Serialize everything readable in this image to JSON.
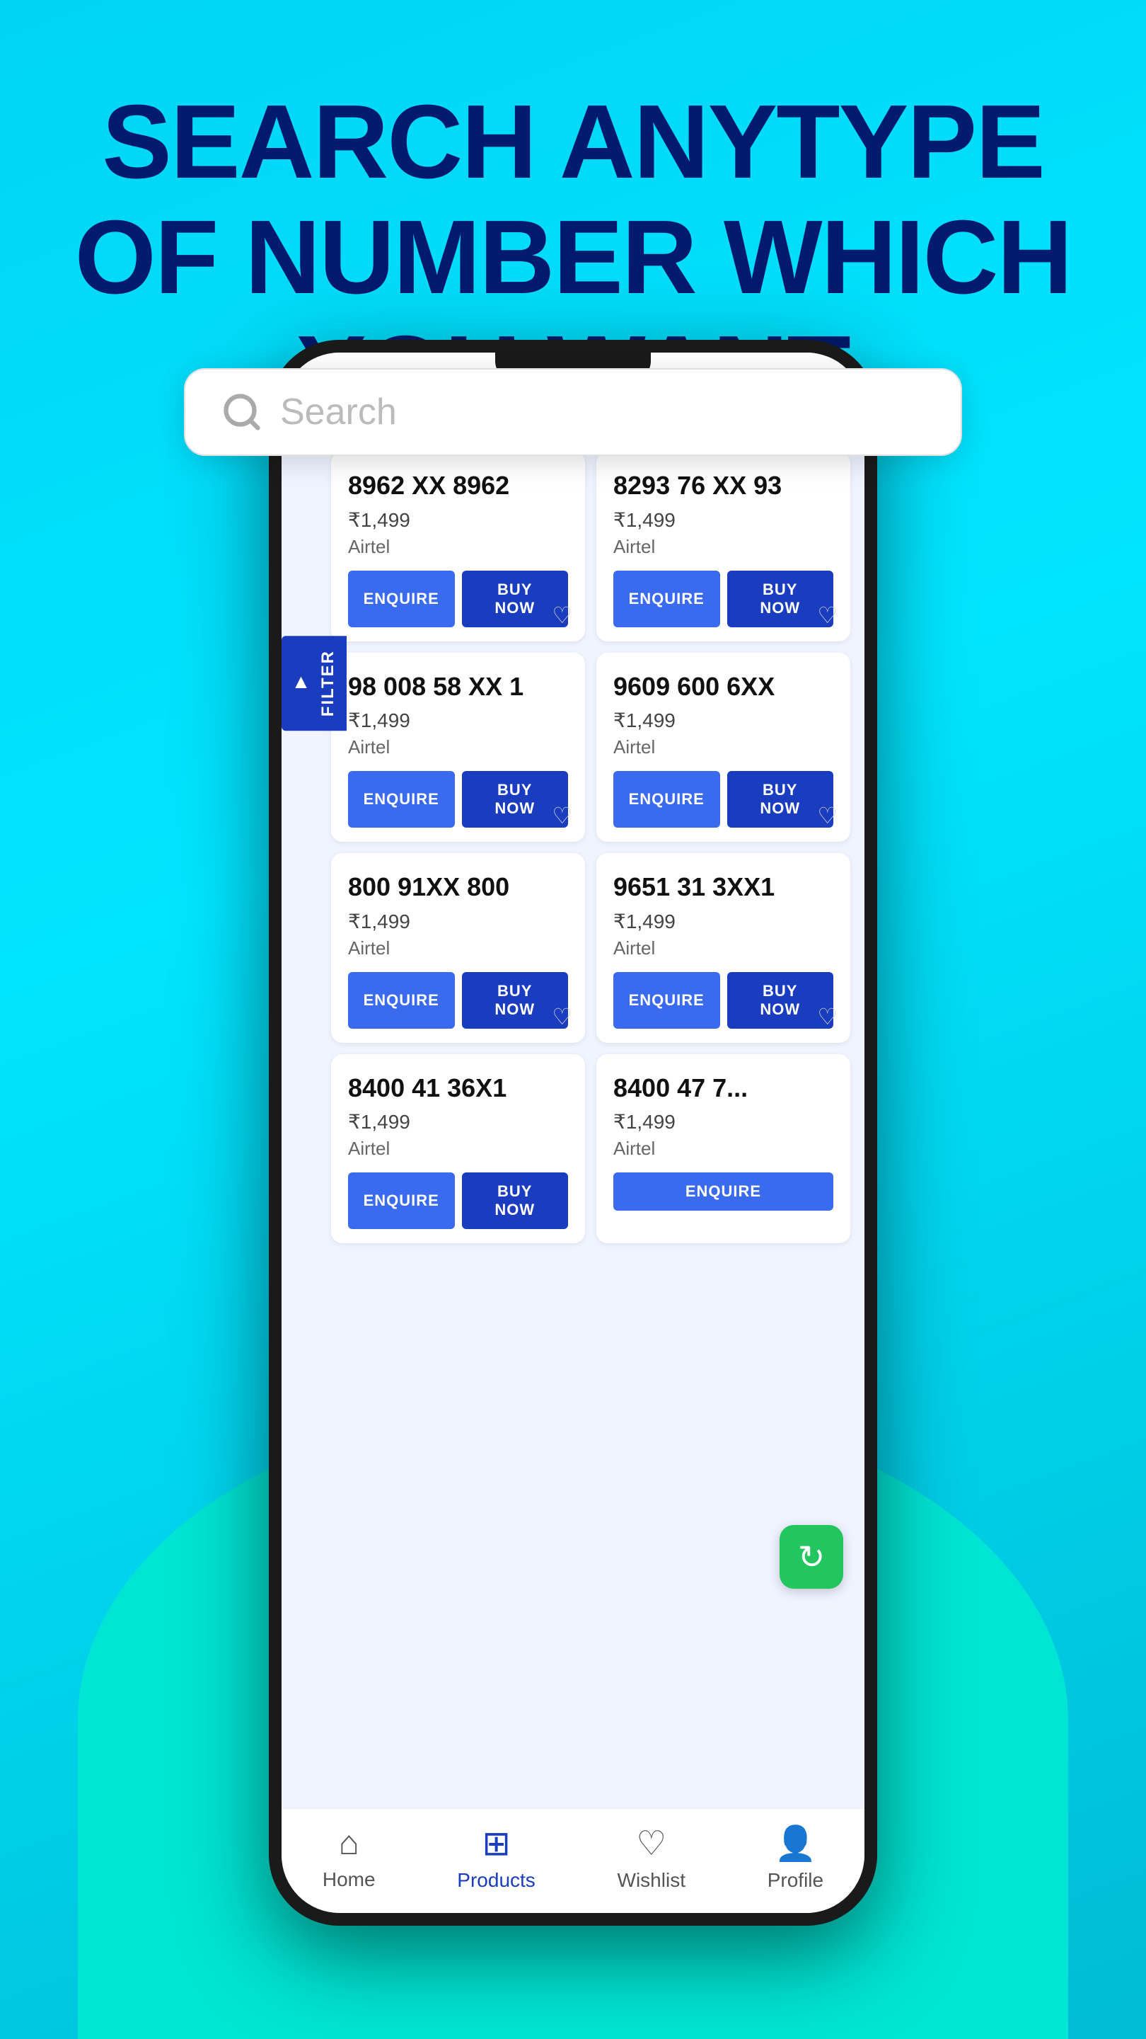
{
  "hero": {
    "title_line1": "SEARCH ANYTYPE",
    "title_line2": "OF NUMBER WHICH",
    "title_line3": "YOU WANT"
  },
  "search": {
    "placeholder": "Search"
  },
  "products": [
    {
      "number": "8962 XX 8962",
      "price": "₹1,499",
      "carrier": "Airtel"
    },
    {
      "number": "8293 76 XX 93",
      "price": "₹1,499",
      "carrier": "Airtel"
    },
    {
      "number": "98 008 58 XX 1",
      "price": "₹1,499",
      "carrier": "Airtel"
    },
    {
      "number": "9609 600 6XX",
      "price": "₹1,499",
      "carrier": "Airtel"
    },
    {
      "number": "800 91XX 800",
      "price": "₹1,499",
      "carrier": "Airtel"
    },
    {
      "number": "9651 31 3XX1",
      "price": "₹1,499",
      "carrier": "Airtel"
    },
    {
      "number": "8400 41 36X1",
      "price": "₹1,499",
      "carrier": "Airtel"
    },
    {
      "number": "8400 47 7...",
      "price": "₹1,499",
      "carrier": "Airtel"
    }
  ],
  "buttons": {
    "enquire": "ENQUIRE",
    "buy_now": "BUY NOW",
    "filter": "FILTER"
  },
  "nav": {
    "home": "Home",
    "products": "Products",
    "wishlist": "Wishlist",
    "profile": "Profile"
  }
}
